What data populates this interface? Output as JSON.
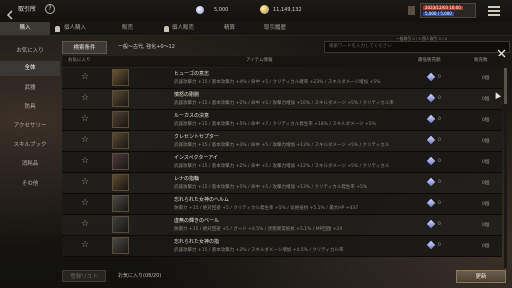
{
  "header": {
    "title": "取引所",
    "silver_amount": "5,000",
    "gold_amount": "11,149,132",
    "status_line1": "2023/12/03 16:00",
    "status_line2": "5,000 / 5,000"
  },
  "tabs": [
    "購入",
    "個人購入",
    "販売",
    "個人販売",
    "精算",
    "取引履歴"
  ],
  "notice": "一般取引 0 / 0    個人取引 0 / 0",
  "sidebar": [
    "お気に入り",
    "全体",
    "武器",
    "防具",
    "アクセサリー",
    "スキルブック",
    "消耗品",
    "その他"
  ],
  "filter": {
    "button": "検索条件",
    "summary": "一般〜古代, 強化+0〜12",
    "search_placeholder": "検索ワードを入力してください"
  },
  "columns": {
    "favorite": "お気に入り",
    "item": "アイテム情報",
    "price": "最低販売額",
    "limit": "販売数"
  },
  "rows": [
    {
      "name": "ヒューゴの意志",
      "desc": "武器攻撃力 +15 / 基本攻撃力 +4% / 命中 +5 / クリティカル確率 +23% / スキルダメージ増加 +5%",
      "count": "0",
      "limit": "0個"
    },
    {
      "name": "憤怒の剛腕",
      "desc": "武器攻撃力 +15 / 基本攻撃力 +2% / 命中 +5 / 攻撃力増加 +10% / スキルダメージ +5% / クリティカル率",
      "count": "0",
      "limit": "0個"
    },
    {
      "name": "ルーカスの決意",
      "desc": "武器攻撃力 +15 / 基本攻撃力 +5% / 命中 +7 / クリティカル発生率 +18% / スキルダメージ +5%",
      "count": "0",
      "limit": "0個"
    },
    {
      "name": "クレセントセプター",
      "desc": "武器攻撃力 +15 / 基本攻撃力 +3% / 命中 +5 / 攻撃力増加 +13% / スキルダメージ +5% / クリティカル",
      "count": "0",
      "limit": "0個"
    },
    {
      "name": "インスペクターアイ",
      "desc": "武器攻撃力 +15 / 基本攻撃力 +2% / 命中 +5 / 攻撃力増加 +12% / スキルダメージ +5% / クリティカル",
      "count": "0",
      "limit": "0個"
    },
    {
      "name": "レナの指輪",
      "desc": "武器攻撃力 +15 / 基本攻撃力 +5% / 命中 +5 / 攻撃力増加 +13% / クリティカル発生率 +5%",
      "count": "0",
      "limit": "0個"
    },
    {
      "name": "忘れられた女神のヘルム",
      "desc": "防御力 +15 / 絶対回避 +5 / クリティカル発生率 +5% / 気絶抵抗 +5.1% / 最大HP +437",
      "count": "0",
      "limit": "0個"
    },
    {
      "name": "虚無の輝きのベール",
      "desc": "防御力 +15 / 絶対回避 +5 / ガード +4.5% / 状態異常抵抗 +5.1% / MP回復 +24",
      "count": "0",
      "limit": "0個"
    },
    {
      "name": "忘れられた女神の指",
      "desc": "武器攻撃力 +15 / 基本攻撃力 +2% / スキルダメージ増加 +4.5% / クリティカル率",
      "count": "0",
      "limit": "0個"
    }
  ],
  "footer": {
    "register_button": "登録リスト",
    "favorites_count": "お気に入り(08/20)",
    "refresh_button": "更新"
  },
  "colors": {
    "accent": "#e2c9a0",
    "active_tab": "#3c3935",
    "refresh": "#5a4f3e"
  },
  "icons": [
    "back-icon",
    "help-icon",
    "silver-coin-icon",
    "gold-coin-icon",
    "status-flag-icon",
    "menu-icon",
    "close-icon",
    "star-icon",
    "gem-icon"
  ]
}
